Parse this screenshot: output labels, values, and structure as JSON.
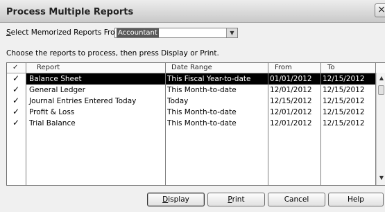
{
  "window": {
    "title": "Process Multiple Reports",
    "close_glyph": "×"
  },
  "select": {
    "label_prefix": "S",
    "label_rest": "elect Memorized Reports From",
    "value": "Accountant"
  },
  "instructions": "Choose the reports to process, then press Display or Print.",
  "table": {
    "headers": {
      "check": "✓",
      "report": "Report",
      "date_range": "Date Range",
      "from": "From",
      "to": "To"
    },
    "rows": [
      {
        "checked": "✓",
        "report": "Balance Sheet",
        "date_range": "This Fiscal Year-to-date",
        "from": "01/01/2012",
        "to": "12/15/2012"
      },
      {
        "checked": "✓",
        "report": "General Ledger",
        "date_range": "This Month-to-date",
        "from": "12/01/2012",
        "to": "12/15/2012"
      },
      {
        "checked": "✓",
        "report": "Journal Entries Entered Today",
        "date_range": "Today",
        "from": "12/15/2012",
        "to": "12/15/2012"
      },
      {
        "checked": "✓",
        "report": "Profit & Loss",
        "date_range": "This Month-to-date",
        "from": "12/01/2012",
        "to": "12/15/2012"
      },
      {
        "checked": "✓",
        "report": "Trial Balance",
        "date_range": "This Month-to-date",
        "from": "12/01/2012",
        "to": "12/15/2012"
      }
    ]
  },
  "buttons": {
    "display": {
      "accel": "D",
      "rest": "isplay"
    },
    "print": {
      "accel": "P",
      "rest": "rint"
    },
    "cancel": "Cancel",
    "help": "Help"
  },
  "colors": {
    "selection": "#000000",
    "selection_text": "#ffffff"
  }
}
